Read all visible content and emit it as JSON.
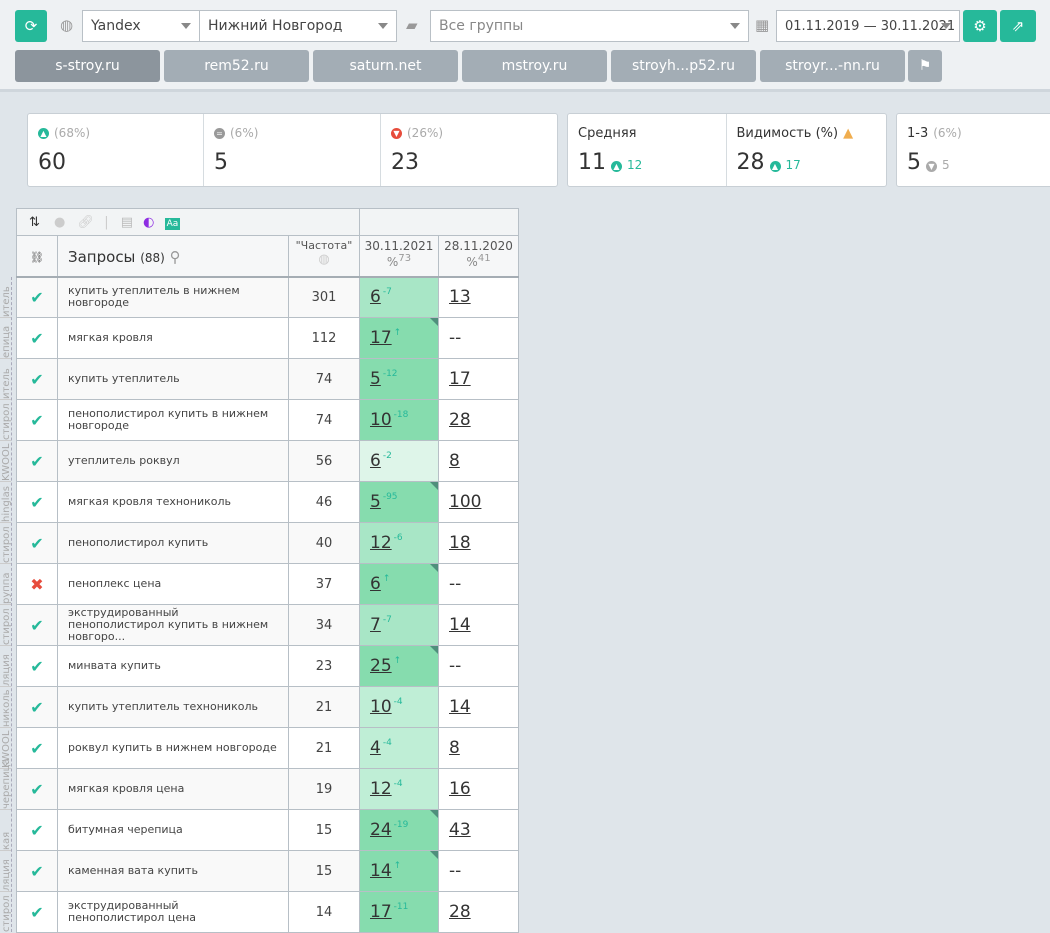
{
  "toolbar": {
    "engine": "Yandex",
    "region": "Нижний Новгород",
    "groups_placeholder": "Все группы",
    "date_range": "01.11.2019 — 30.11.2021"
  },
  "sites": [
    "s-stroy.ru",
    "rem52.ru",
    "saturn.net",
    "mstroy.ru",
    "stroyh...p52.ru",
    "stroyr...-nn.ru"
  ],
  "summary": {
    "up": {
      "pct": "(68%)",
      "value": "60"
    },
    "same": {
      "pct": "(6%)",
      "value": "5"
    },
    "down": {
      "pct": "(26%)",
      "value": "23"
    },
    "avg": {
      "label": "Средняя",
      "value": "11",
      "delta": "12"
    },
    "visibility": {
      "label": "Видимость (%)",
      "value": "28",
      "delta": "17"
    },
    "top3": {
      "label": "1-3",
      "pct": "(6%)",
      "value": "5",
      "delta": "5"
    }
  },
  "table": {
    "query_header": "Запросы",
    "query_count": "(88)",
    "freq_header": "\"Частота\"",
    "dates": [
      {
        "date": "30.11.2021",
        "pct": "73"
      },
      {
        "date": "28.11.2020",
        "pct": "41"
      }
    ],
    "rows": [
      {
        "ok": true,
        "q": "купить утеплитель в нижнем новгороде",
        "f": "301",
        "p": "6",
        "d": "-7",
        "prev": "13",
        "shade": "#a8e6c6",
        "corner": false,
        "grp": "итель"
      },
      {
        "ok": true,
        "q": "мягкая кровля",
        "f": "112",
        "p": "17",
        "d": "↑",
        "prev": "--",
        "shade": "#86dcae",
        "corner": true,
        "grp": "епица"
      },
      {
        "ok": true,
        "q": "купить утеплитель",
        "f": "74",
        "p": "5",
        "d": "-12",
        "prev": "17",
        "shade": "#86dcae",
        "corner": false,
        "grp": "итель"
      },
      {
        "ok": true,
        "q": "пенополистирол купить в нижнем новгороде",
        "f": "74",
        "p": "10",
        "d": "-18",
        "prev": "28",
        "shade": "#86dcae",
        "corner": false,
        "grp": "стирол"
      },
      {
        "ok": true,
        "q": "утеплитель роквул",
        "f": "56",
        "p": "6",
        "d": "-2",
        "prev": "8",
        "shade": "#def5e9",
        "corner": false,
        "grp": "KWOOL"
      },
      {
        "ok": true,
        "q": "мягкая кровля технониколь",
        "f": "46",
        "p": "5",
        "d": "-95",
        "prev": "100",
        "shade": "#86dcae",
        "corner": true,
        "grp": "hinglas"
      },
      {
        "ok": true,
        "q": "пенополистирол купить",
        "f": "40",
        "p": "12",
        "d": "-6",
        "prev": "18",
        "shade": "#a8e6c6",
        "corner": false,
        "grp": "стирол"
      },
      {
        "ok": false,
        "q": "пеноплекс цена",
        "f": "37",
        "p": "6",
        "d": "↑",
        "prev": "--",
        "shade": "#86dcae",
        "corner": true,
        "grp": "руппа"
      },
      {
        "ok": true,
        "q": "экструдированный пенополистирол купить в нижнем новгоро...",
        "f": "34",
        "p": "7",
        "d": "-7",
        "prev": "14",
        "shade": "#a8e6c6",
        "corner": false,
        "grp": "стирол"
      },
      {
        "ok": true,
        "q": "минвата купить",
        "f": "23",
        "p": "25",
        "d": "↑",
        "prev": "--",
        "shade": "#86dcae",
        "corner": true,
        "grp": "ляция"
      },
      {
        "ok": true,
        "q": "купить утеплитель технониколь",
        "f": "21",
        "p": "10",
        "d": "-4",
        "prev": "14",
        "shade": "#bfeed6",
        "corner": false,
        "grp": "николь"
      },
      {
        "ok": true,
        "q": "роквул купить в нижнем новгороде",
        "f": "21",
        "p": "4",
        "d": "-4",
        "prev": "8",
        "shade": "#bfeed6",
        "corner": false,
        "grp": "KWOOL"
      },
      {
        "ok": true,
        "q": "мягкая кровля цена",
        "f": "19",
        "p": "12",
        "d": "-4",
        "prev": "16",
        "shade": "#bfeed6",
        "corner": false,
        "grp": "черепица"
      },
      {
        "ok": true,
        "q": "битумная черепица",
        "f": "15",
        "p": "24",
        "d": "-19",
        "prev": "43",
        "shade": "#86dcae",
        "corner": true,
        "grp": "кая"
      },
      {
        "ok": true,
        "q": "каменная вата купить",
        "f": "15",
        "p": "14",
        "d": "↑",
        "prev": "--",
        "shade": "#86dcae",
        "corner": true,
        "grp": "ляция"
      },
      {
        "ok": true,
        "q": "экструдированный пенополистирол цена",
        "f": "14",
        "p": "17",
        "d": "-11",
        "prev": "28",
        "shade": "#86dcae",
        "corner": false,
        "grp": "стирол"
      }
    ]
  },
  "colors": {
    "accent": "#26b99a",
    "down": "#e74c3c",
    "warn": "#f0ad4e"
  }
}
